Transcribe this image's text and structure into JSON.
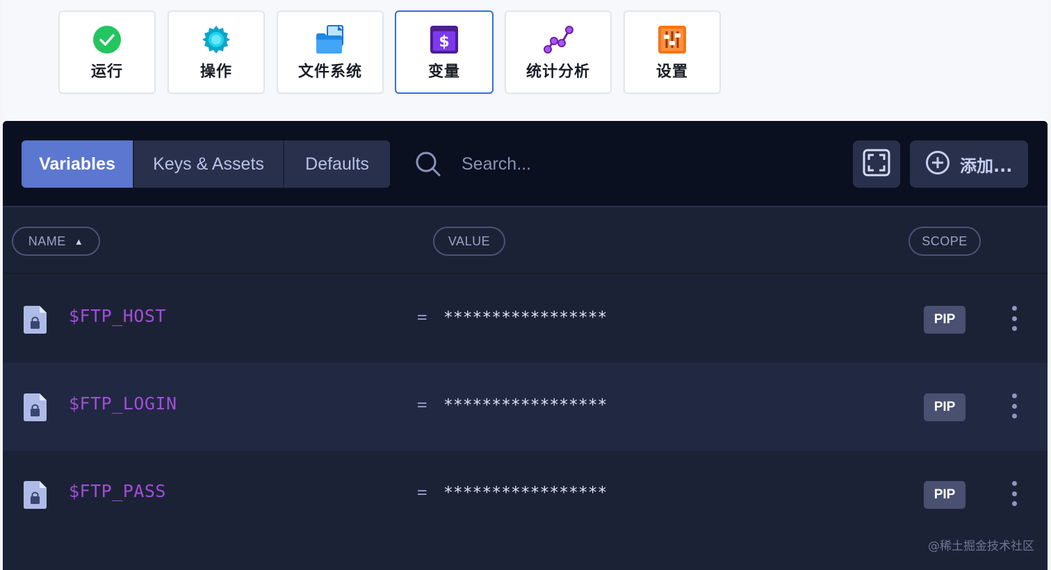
{
  "top_tools": [
    {
      "label": "运行",
      "icon": "check-circle-icon"
    },
    {
      "label": "操作",
      "icon": "gear-badge-icon"
    },
    {
      "label": "文件系统",
      "icon": "folder-file-icon"
    },
    {
      "label": "变量",
      "icon": "dollar-sign-icon",
      "active": true
    },
    {
      "label": "统计分析",
      "icon": "graph-nodes-icon"
    },
    {
      "label": "设置",
      "icon": "sliders-icon"
    }
  ],
  "tabs": [
    {
      "label": "Variables",
      "active": true
    },
    {
      "label": "Keys & Assets"
    },
    {
      "label": "Defaults"
    }
  ],
  "search": {
    "placeholder": "Search..."
  },
  "add_button_label": "添加...",
  "columns": {
    "name": "NAME",
    "value": "VALUE",
    "scope": "SCOPE"
  },
  "rows": [
    {
      "name": "$FTP_HOST",
      "equals": "=",
      "value": "*****************",
      "scope": "PIP"
    },
    {
      "name": "$FTP_LOGIN",
      "equals": "=",
      "value": "*****************",
      "scope": "PIP"
    },
    {
      "name": "$FTP_PASS",
      "equals": "=",
      "value": "*****************",
      "scope": "PIP"
    }
  ],
  "watermark": "@稀土掘金技术社区",
  "colors": {
    "active_tab": "#5b77cf",
    "var_name": "#a14ed8",
    "panel_bg": "#1c2236",
    "toolbar_bg": "#0b1020",
    "active_card_border": "#2f6fe0"
  }
}
